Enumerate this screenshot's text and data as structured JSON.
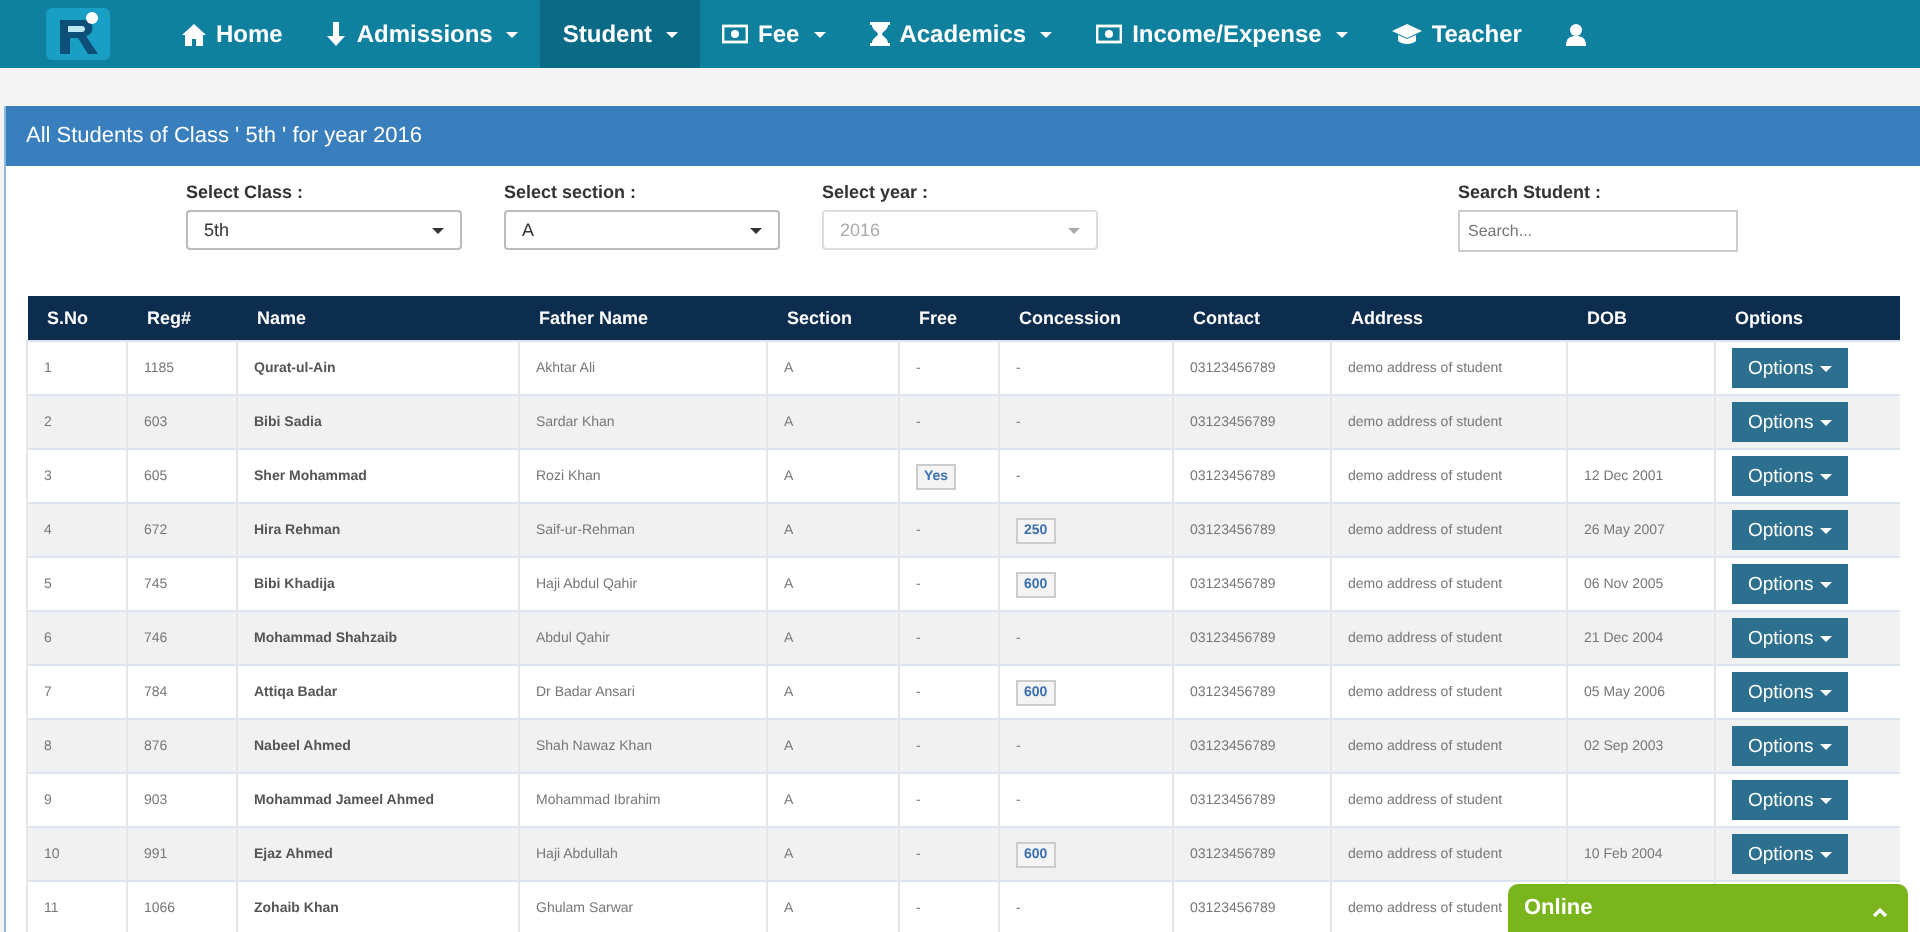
{
  "navbar": {
    "items": [
      {
        "label": "Home",
        "kind": "home",
        "caret": false,
        "selected": false
      },
      {
        "label": "Admissions",
        "kind": "download",
        "caret": true,
        "selected": false
      },
      {
        "label": "Student",
        "kind": "plain",
        "caret": true,
        "selected": true
      },
      {
        "label": "Fee",
        "kind": "money",
        "caret": true,
        "selected": false
      },
      {
        "label": "Academics",
        "kind": "hourglass",
        "caret": true,
        "selected": false
      },
      {
        "label": "Income/Expense",
        "kind": "money",
        "caret": true,
        "selected": false
      },
      {
        "label": "Teacher",
        "kind": "teacher",
        "caret": false,
        "selected": false
      },
      {
        "kind": "user",
        "caret": false,
        "selected": false
      }
    ]
  },
  "panel": {
    "title": "All Students of Class ' 5th ' for year 2016",
    "filters": [
      {
        "label": "Select Class :",
        "kind": "select",
        "value": "5th",
        "disabled": false
      },
      {
        "label": "Select section :",
        "kind": "select",
        "value": "A",
        "disabled": false
      },
      {
        "label": "Select year :",
        "kind": "select",
        "value": "2016",
        "disabled": true
      },
      {
        "label": "Search Student :",
        "kind": "search",
        "placeholder": "Search..."
      }
    ],
    "table": {
      "columns": [
        "S.No",
        "Reg#",
        "Name",
        "Father Name",
        "Section",
        "Free",
        "Concession",
        "Contact",
        "Address",
        "DOB",
        "Options"
      ],
      "rows": [
        {
          "sno": "1",
          "reg": "1185",
          "name": "Qurat-ul-Ain",
          "father": "Akhtar Ali",
          "section": "A",
          "free": {
            "text": "-",
            "badge": false
          },
          "concession": {
            "text": "-",
            "badge": false
          },
          "contact": "03123456789",
          "address": "demo address of student",
          "options": "Options"
        },
        {
          "sno": "2",
          "reg": "603",
          "name": "Bibi Sadia",
          "father": "Sardar Khan",
          "section": "A",
          "free": {
            "text": "-",
            "badge": false
          },
          "concession": {
            "text": "-",
            "badge": false
          },
          "contact": "03123456789",
          "address": "demo address of student",
          "options": "Options"
        },
        {
          "sno": "3",
          "reg": "605",
          "name": "Sher Mohammad",
          "father": "Rozi Khan",
          "section": "A",
          "free": {
            "text": "Yes",
            "badge": true
          },
          "concession": {
            "text": "-",
            "badge": false
          },
          "contact": "03123456789",
          "address": "demo address of student",
          "dob": "12 Dec 2001",
          "options": "Options"
        },
        {
          "sno": "4",
          "reg": "672",
          "name": "Hira Rehman",
          "father": "Saif-ur-Rehman",
          "section": "A",
          "free": {
            "text": "-",
            "badge": false
          },
          "concession": {
            "text": "250",
            "badge": true
          },
          "contact": "03123456789",
          "address": "demo address of student",
          "dob": "26 May 2007",
          "options": "Options"
        },
        {
          "sno": "5",
          "reg": "745",
          "name": "Bibi Khadija",
          "father": "Haji Abdul Qahir",
          "section": "A",
          "free": {
            "text": "-",
            "badge": false
          },
          "concession": {
            "text": "600",
            "badge": true
          },
          "contact": "03123456789",
          "address": "demo address of student",
          "dob": "06 Nov 2005",
          "options": "Options"
        },
        {
          "sno": "6",
          "reg": "746",
          "name": "Mohammad Shahzaib",
          "father": "Abdul Qahir",
          "section": "A",
          "free": {
            "text": "-",
            "badge": false
          },
          "concession": {
            "text": "-",
            "badge": false
          },
          "contact": "03123456789",
          "address": "demo address of student",
          "dob": "21 Dec 2004",
          "options": "Options"
        },
        {
          "sno": "7",
          "reg": "784",
          "name": "Attiqa Badar",
          "father": "Dr Badar Ansari",
          "section": "A",
          "free": {
            "text": "-",
            "badge": false
          },
          "concession": {
            "text": "600",
            "badge": true
          },
          "contact": "03123456789",
          "address": "demo address of student",
          "dob": "05 May 2006",
          "options": "Options"
        },
        {
          "sno": "8",
          "reg": "876",
          "name": "Nabeel Ahmed",
          "father": "Shah Nawaz Khan",
          "section": "A",
          "free": {
            "text": "-",
            "badge": false
          },
          "concession": {
            "text": "-",
            "badge": false
          },
          "contact": "03123456789",
          "address": "demo address of student",
          "dob": "02 Sep 2003",
          "options": "Options"
        },
        {
          "sno": "9",
          "reg": "903",
          "name": "Mohammad Jameel Ahmed",
          "father": "Mohammad Ibrahim",
          "section": "A",
          "free": {
            "text": "-",
            "badge": false
          },
          "concession": {
            "text": "-",
            "badge": false
          },
          "contact": "03123456789",
          "address": "demo address of student",
          "options": "Options"
        },
        {
          "sno": "10",
          "reg": "991",
          "name": "Ejaz Ahmed",
          "father": "Haji Abdullah",
          "section": "A",
          "free": {
            "text": "-",
            "badge": false
          },
          "concession": {
            "text": "600",
            "badge": true
          },
          "contact": "03123456789",
          "address": "demo address of student",
          "dob": "10 Feb 2004",
          "options": "Options"
        },
        {
          "sno": "11",
          "reg": "1066",
          "name": "Zohaib Khan",
          "father": "Ghulam Sarwar",
          "section": "A",
          "free": {
            "text": "-",
            "badge": false
          },
          "concession": {
            "text": "-",
            "badge": false
          },
          "contact": "03123456789",
          "address": "demo address of student"
        }
      ]
    }
  },
  "chat_widget": {
    "label": "Online",
    "expanded": false
  }
}
